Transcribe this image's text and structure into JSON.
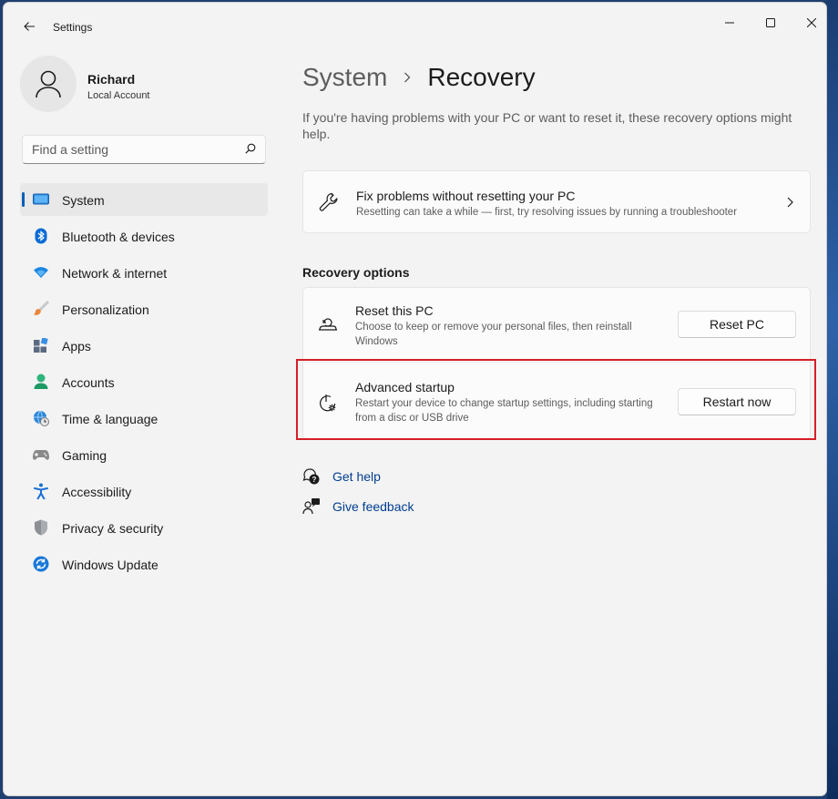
{
  "window": {
    "title": "Settings"
  },
  "profile": {
    "name": "Richard",
    "account_type": "Local Account"
  },
  "search": {
    "placeholder": "Find a setting"
  },
  "nav": {
    "items": [
      {
        "label": "System",
        "icon": "system-icon",
        "selected": true
      },
      {
        "label": "Bluetooth & devices",
        "icon": "bluetooth-icon"
      },
      {
        "label": "Network & internet",
        "icon": "network-icon"
      },
      {
        "label": "Personalization",
        "icon": "brush-icon"
      },
      {
        "label": "Apps",
        "icon": "apps-icon"
      },
      {
        "label": "Accounts",
        "icon": "accounts-icon"
      },
      {
        "label": "Time & language",
        "icon": "globe-clock-icon"
      },
      {
        "label": "Gaming",
        "icon": "gamepad-icon"
      },
      {
        "label": "Accessibility",
        "icon": "accessibility-icon"
      },
      {
        "label": "Privacy & security",
        "icon": "shield-icon"
      },
      {
        "label": "Windows Update",
        "icon": "update-icon"
      }
    ]
  },
  "main": {
    "breadcrumb_parent": "System",
    "breadcrumb_current": "Recovery",
    "intro": "If you're having problems with your PC or want to reset it, these recovery options might help.",
    "fix_card": {
      "title": "Fix problems without resetting your PC",
      "description": "Resetting can take a while — first, try resolving issues by running a troubleshooter"
    },
    "recovery_options_title": "Recovery options",
    "reset_card": {
      "title": "Reset this PC",
      "description": "Choose to keep or remove your personal files, then reinstall Windows",
      "button": "Reset PC"
    },
    "advanced_card": {
      "title": "Advanced startup",
      "description": "Restart your device to change startup settings, including starting from a disc or USB drive",
      "button": "Restart now"
    },
    "links": {
      "get_help": "Get help",
      "give_feedback": "Give feedback"
    }
  },
  "colors": {
    "accent": "#005fb8",
    "link": "#003e92",
    "highlight_border": "#d51f26",
    "window_bg": "#f3f3f3",
    "card_bg": "#fbfbfb"
  }
}
